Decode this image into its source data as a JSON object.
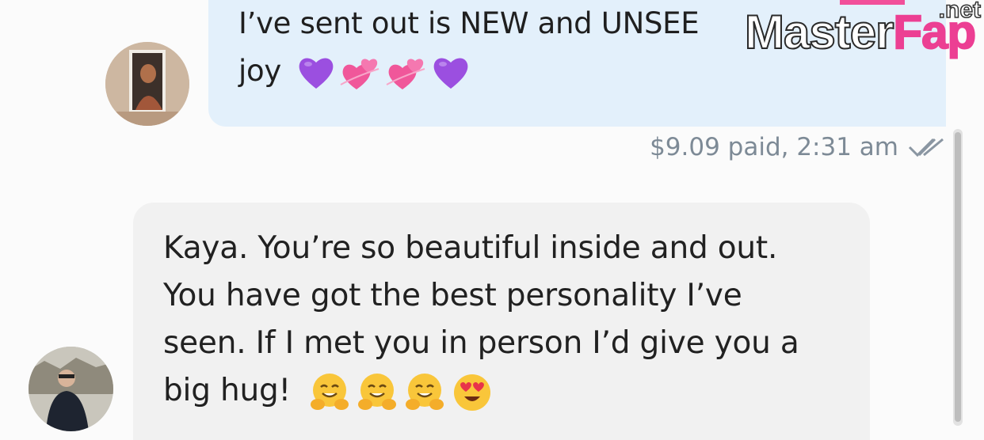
{
  "sent_message": {
    "line1": "I’ve sent out is NEW and UNSEE",
    "line2": "joy",
    "emojis": [
      "purple-heart",
      "two-hearts",
      "two-hearts",
      "purple-heart"
    ]
  },
  "receipt": {
    "text": "$9.09 paid, 2:31 am",
    "status_icon": "double-check-icon"
  },
  "received_message": {
    "line1": "Kaya. You’re so beautiful inside and out.",
    "line2": "You have got the best personality I’ve",
    "line3": "seen. If I met you in person I’d give you a",
    "line4": "big hug!",
    "emojis": [
      "hugging-face",
      "hugging-face",
      "hugging-face",
      "heart-eyes"
    ]
  },
  "watermark": {
    "brand_a": "Master",
    "brand_b": "Fap",
    "tld": ".net"
  },
  "colors": {
    "sent_bubble": "#e3f0fb",
    "received_bubble": "#f1f1f1",
    "meta_text": "#7d8a96",
    "watermark_pink": "#ec3f93"
  }
}
